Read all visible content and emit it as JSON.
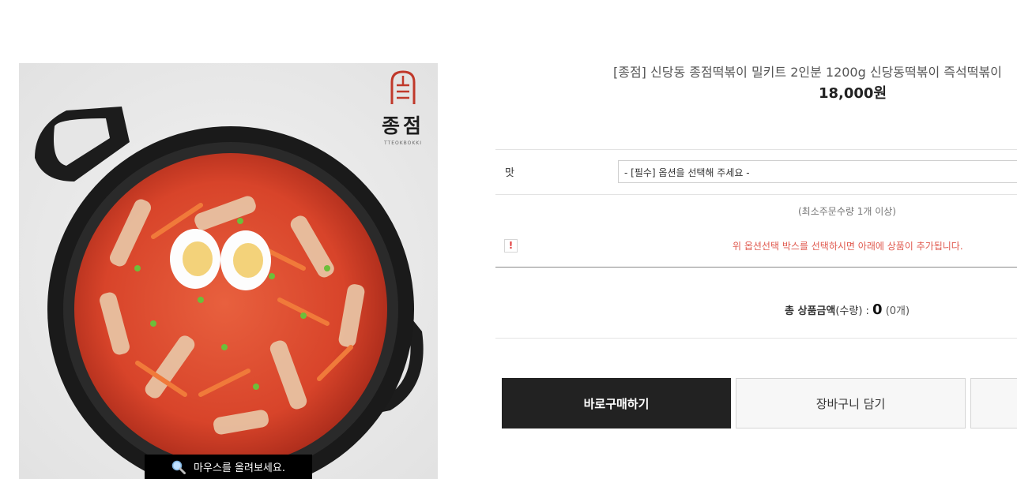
{
  "product": {
    "title": "[종점] 신당동 종점떡볶이 밀키트 2인분 1200g 신당동떡볶이 즉석떡볶이",
    "price": "18,000원"
  },
  "brand": {
    "logo_text": "종점",
    "logo_subtext": "TTEOKBOKKI",
    "accent_color": "#c0392b"
  },
  "image": {
    "zoom_hint": "마우스를 올려보세요."
  },
  "options": {
    "label": "맛",
    "select_value": "- [필수] 옵션을 선택해 주세요 -"
  },
  "notices": {
    "min_quantity": "(최소주문수량 1개 이상)",
    "warning_icon": "!",
    "warning_text": "위 옵션선택 박스를 선택하시면 아래에 상품이 추가됩니다."
  },
  "total": {
    "label_bold": "총 상품금액",
    "label_suffix": "(수량) : ",
    "amount": "0",
    "count": " (0개)"
  },
  "buttons": {
    "buy_now": "바로구매하기",
    "add_to_cart": "장바구니 담기"
  }
}
